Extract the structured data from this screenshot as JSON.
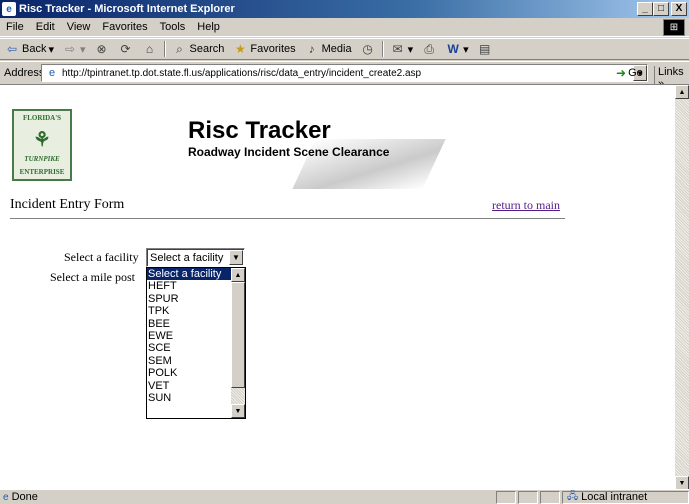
{
  "window": {
    "title": "Risc Tracker - Microsoft Internet Explorer",
    "minimize": "_",
    "maximize": "□",
    "close": "X"
  },
  "menu": [
    "File",
    "Edit",
    "View",
    "Favorites",
    "Tools",
    "Help"
  ],
  "toolbar": {
    "back": "Back",
    "search": "Search",
    "favorites": "Favorites",
    "media": "Media"
  },
  "address": {
    "label": "Address",
    "url": "http://tpintranet.tp.dot.state.fl.us/applications/risc/data_entry/incident_create2.asp",
    "go": "Go",
    "links": "Links"
  },
  "logo": {
    "line1": "FLORIDA'S",
    "line2": "TURNPIKE",
    "line3": "ENTERPRISE"
  },
  "banner": {
    "title": "Risc Tracker",
    "subtitle": "Roadway Incident Scene Clearance"
  },
  "form": {
    "title": "Incident Entry Form",
    "return_link": "return to main",
    "facility_label": "Select a facility",
    "milepost_label": "Select a mile post",
    "facility_selected": "Select a facility",
    "facility_options": [
      "Select a facility",
      "HEFT",
      "SPUR",
      "TPK",
      "BEE",
      "EWE",
      "SCE",
      "SEM",
      "POLK",
      "VET",
      "SUN"
    ],
    "highlighted_option": "Select a facility"
  },
  "status": {
    "text": "Done",
    "zone": "Local intranet"
  }
}
